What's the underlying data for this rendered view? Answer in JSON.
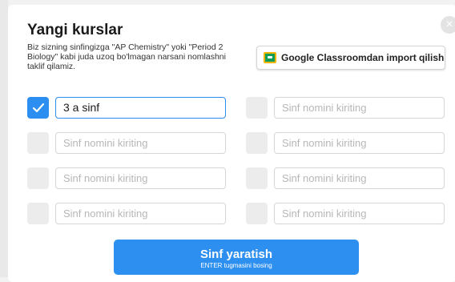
{
  "dialog": {
    "title": "Yangi kurslar",
    "subtitle": "Biz sizning sinfingizga \"AP Chemistry\" yoki \"Period 2 Biology\" kabi juda uzoq bo'lmagan narsani nomlashni taklif qilamiz.",
    "close_icon": "x",
    "google_button_label": "Google Classroomdan import qilish...",
    "placeholder": "Sinf nomini kiriting",
    "rows": [
      {
        "left_value": "3 a sinf",
        "left_checked": true,
        "right_value": "",
        "right_checked": false
      },
      {
        "left_value": "",
        "left_checked": false,
        "right_value": "",
        "right_checked": false
      },
      {
        "left_value": "",
        "left_checked": false,
        "right_value": "",
        "right_checked": false
      },
      {
        "left_value": "",
        "left_checked": false,
        "right_value": "",
        "right_checked": false
      }
    ],
    "create_button_label": "Sinf yaratish",
    "create_button_hint": "ENTER tugmasini bosing"
  },
  "colors": {
    "accent": "#2d8ff0",
    "checkbox_empty": "#ececec"
  }
}
